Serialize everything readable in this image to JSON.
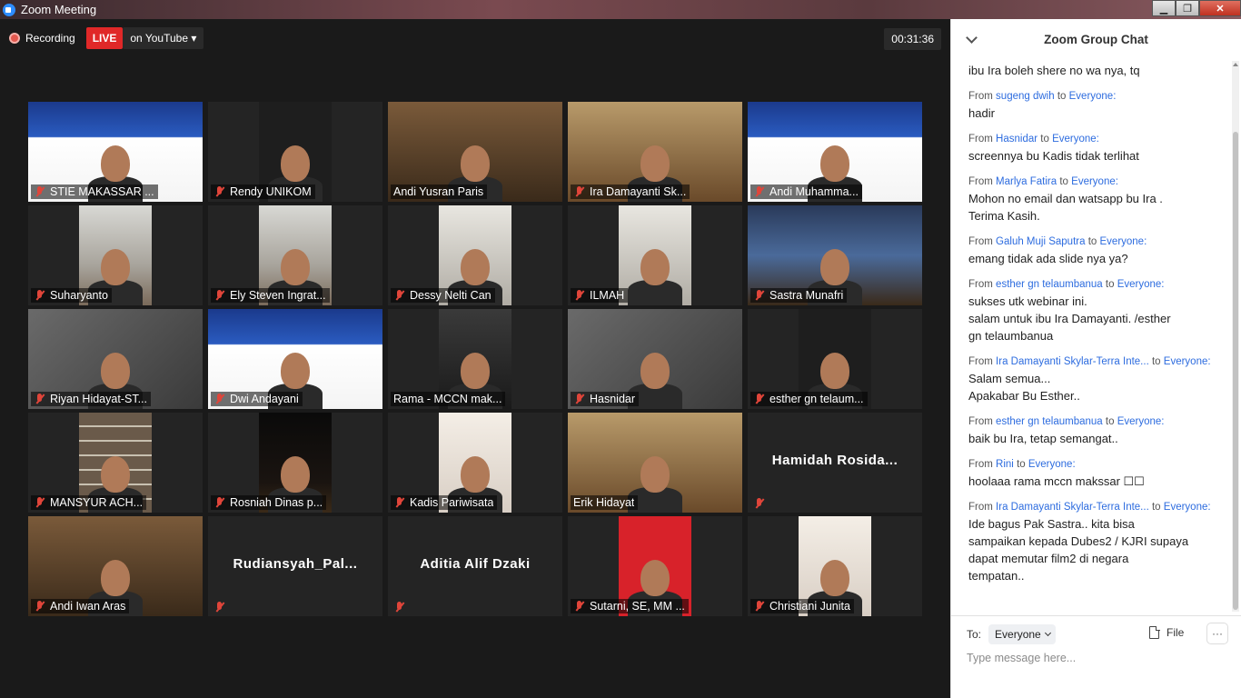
{
  "window": {
    "title": "Zoom Meeting",
    "minimize": "▁",
    "maximize": "❐",
    "close": "✕"
  },
  "topbar": {
    "recording_label": "Recording",
    "live_label": "LIVE",
    "stream_label": "on YouTube ▾",
    "timer": "00:31:36"
  },
  "participants": [
    {
      "name": "STIE MAKASSAR ...",
      "bg": "bg-webinar",
      "muted": true
    },
    {
      "name": "Rendy UNIKOM",
      "bg": "bg-dark",
      "muted": true
    },
    {
      "name": "Andi Yusran Paris",
      "bg": "bg-warm",
      "muted": false,
      "active": true
    },
    {
      "name": "Ira Damayanti Sk...",
      "bg": "bg-brown",
      "muted": true
    },
    {
      "name": "Andi Muhamma...",
      "bg": "bg-webinar",
      "muted": true
    },
    {
      "name": "Suharyanto",
      "bg": "bg-room",
      "muted": true
    },
    {
      "name": "Ely Steven Ingrat...",
      "bg": "bg-room",
      "muted": true
    },
    {
      "name": "Dessy Nelti Can",
      "bg": "bg-light",
      "muted": true
    },
    {
      "name": "ILMAH",
      "bg": "bg-light",
      "muted": true
    },
    {
      "name": "Sastra Munafri",
      "bg": "bg-stage",
      "muted": true
    },
    {
      "name": "Riyan Hidayat-ST...",
      "bg": "bg-grey",
      "muted": true
    },
    {
      "name": "Dwi Andayani",
      "bg": "bg-webinar",
      "muted": true
    },
    {
      "name": "Rama - MCCN mak...",
      "bg": "bg-studio",
      "muted": false
    },
    {
      "name": "Hasnidar",
      "bg": "bg-grey",
      "muted": true
    },
    {
      "name": "esther gn telaum...",
      "bg": "bg-dark",
      "muted": true
    },
    {
      "name": "MANSYUR ACH...",
      "bg": "bg-shelf",
      "muted": true
    },
    {
      "name": "Rosniah Dinas p...",
      "bg": "bg-night",
      "muted": true
    },
    {
      "name": "Kadis Pariwisata",
      "bg": "bg-pink",
      "muted": true
    },
    {
      "name": "Erik Hidayat",
      "bg": "bg-brown",
      "muted": false
    },
    {
      "name": "",
      "center_name": "Hamidah Rosida...",
      "bg": "none",
      "muted": true
    },
    {
      "name": "Andi Iwan Aras",
      "bg": "bg-warm",
      "muted": true
    },
    {
      "name": "",
      "center_name": "Rudiansyah_Pal...",
      "bg": "none",
      "muted": true
    },
    {
      "name": "",
      "center_name": "Aditia Alif Dzaki",
      "bg": "none",
      "muted": true
    },
    {
      "name": "Sutarni, SE, MM ...",
      "bg": "bg-red",
      "muted": true
    },
    {
      "name": "Christiani Junita",
      "bg": "bg-pink",
      "muted": true
    }
  ],
  "chat": {
    "title": "Zoom Group Chat",
    "messages": [
      {
        "from": "",
        "to": "",
        "text": "ibu Ira boleh shere no wa nya, tq"
      },
      {
        "from": "sugeng dwih",
        "to": "Everyone:",
        "text": "hadir"
      },
      {
        "from": "Hasnidar",
        "to": "Everyone:",
        "text": "screennya bu Kadis tidak terlihat"
      },
      {
        "from": "Marlya Fatira",
        "to": "Everyone:",
        "text": "Mohon no email dan watsapp bu Ira .\nTerima Kasih."
      },
      {
        "from": "Galuh Muji Saputra",
        "to": "Everyone:",
        "text": "emang tidak ada slide nya ya?"
      },
      {
        "from": "esther gn telaumbanua",
        "to": "Everyone:",
        "text": "sukses utk webinar ini.\nsalam untuk ibu Ira Damayanti. /esther\ngn telaumbanua"
      },
      {
        "from": "Ira Damayanti Skylar-Terra Inte...",
        "to": "Everyone:",
        "text": "Salam  semua...\nApakabar Bu Esther.."
      },
      {
        "from": "esther gn telaumbanua",
        "to": "Everyone:",
        "text": "baik bu Ira, tetap semangat.."
      },
      {
        "from": "Rini",
        "to": "Everyone:",
        "text": "hoolaaa rama mccn makssar ☐☐"
      },
      {
        "from": "Ira Damayanti Skylar-Terra Inte...",
        "to": "Everyone:",
        "text": "Ide bagus Pak Sastra.. kita bisa\nsampaikan kepada Dubes2 / KJRI supaya\ndapat memutar film2 di negara\ntempatan.."
      }
    ],
    "from_label": "From",
    "to_label": "to",
    "compose": {
      "to_label": "To:",
      "recipient": "Everyone",
      "file_label": "File",
      "more_label": "···",
      "placeholder": "Type message here..."
    }
  }
}
